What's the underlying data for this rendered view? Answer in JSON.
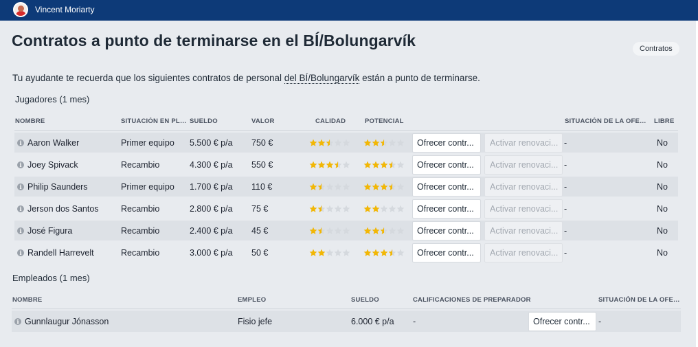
{
  "user": {
    "name": "Vincent Moriarty"
  },
  "page": {
    "title": "Contratos a punto de terminarse en el BÍ/Bolungarvík",
    "chip": "Contratos",
    "intro_before": "Tu ayudante te recuerda que los siguientes contratos de personal ",
    "intro_link": "del BÍ/Bolungarvík",
    "intro_after": " están a punto de terminarse."
  },
  "players": {
    "title": "Jugadores (1 mes)",
    "columns": {
      "name": "NOMBRE",
      "situation": "SITUACIÓN EN PLA...",
      "salary": "SUELDO",
      "value": "VALOR",
      "quality": "CALIDAD",
      "potential": "POTENCIAL",
      "offer_situation": "SITUACIÓN DE LA OFER...",
      "free": "LIBRE"
    },
    "rows": [
      {
        "name": "Aaron Walker",
        "situation": "Primer equipo",
        "salary": "5.500 € p/a",
        "value": "750 €",
        "quality": 2.5,
        "potential": 2.5,
        "offer_button": "Ofrecer contr...",
        "renew_button": "Activar renovaci...",
        "offer_situation": "-",
        "free": "No"
      },
      {
        "name": "Joey Spivack",
        "situation": "Recambio",
        "salary": "4.300 € p/a",
        "value": "550 €",
        "quality": 3.5,
        "potential": 3.5,
        "offer_button": "Ofrecer contr...",
        "renew_button": "Activar renovaci...",
        "offer_situation": "-",
        "free": "No"
      },
      {
        "name": "Philip Saunders",
        "situation": "Primer equipo",
        "salary": "1.700 € p/a",
        "value": "110 €",
        "quality": 1.5,
        "potential": 3.5,
        "offer_button": "Ofrecer contr...",
        "renew_button": "Activar renovaci...",
        "offer_situation": "-",
        "free": "No"
      },
      {
        "name": "Jerson dos Santos",
        "situation": "Recambio",
        "salary": "2.800 € p/a",
        "value": "75 €",
        "quality": 1.5,
        "potential": 2,
        "offer_button": "Ofrecer contr...",
        "renew_button": "Activar renovaci...",
        "offer_situation": "-",
        "free": "No"
      },
      {
        "name": "José Figura",
        "situation": "Recambio",
        "salary": "2.400 € p/a",
        "value": "45 €",
        "quality": 1.5,
        "potential": 2.5,
        "offer_button": "Ofrecer contr...",
        "renew_button": "Activar renovaci...",
        "offer_situation": "-",
        "free": "No"
      },
      {
        "name": "Randell Harrevelt",
        "situation": "Recambio",
        "salary": "3.000 € p/a",
        "value": "50 €",
        "quality": 2,
        "potential": 3.5,
        "offer_button": "Ofrecer contr...",
        "renew_button": "Activar renovaci...",
        "offer_situation": "-",
        "free": "No"
      }
    ]
  },
  "staff": {
    "title": "Empleados (1 mes)",
    "columns": {
      "name": "NOMBRE",
      "role": "EMPLEO",
      "salary": "SUELDO",
      "ratings": "CALIFICACIONES DE PREPARADOR",
      "offer_situation": "SITUACIÓN DE LA OFER..."
    },
    "rows": [
      {
        "name": "Gunnlaugur Jónasson",
        "role": "Fisio jefe",
        "salary": "6.000 € p/a",
        "ratings": "-",
        "offer_button": "Ofrecer contr...",
        "offer_situation": "-"
      }
    ]
  },
  "colors": {
    "topbar": "#0d3a78",
    "star_filled": "#f2b705",
    "star_empty": "#d5d9de",
    "row_alt": "#dde1e6"
  }
}
